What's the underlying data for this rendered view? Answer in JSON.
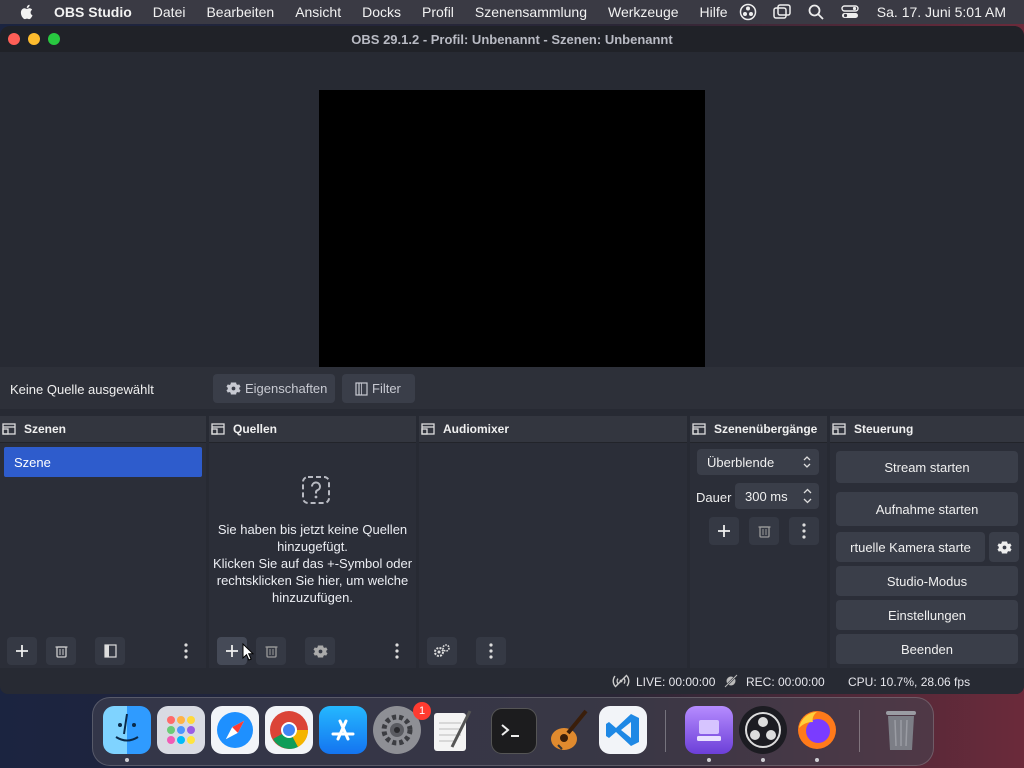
{
  "menubar": {
    "app_name": "OBS Studio",
    "items": [
      "Datei",
      "Bearbeiten",
      "Ansicht",
      "Docks",
      "Profil",
      "Szenensammlung",
      "Werkzeuge",
      "Hilfe"
    ],
    "clock": "Sa. 17. Juni  5:01 AM"
  },
  "window": {
    "title": "OBS 29.1.2 - Profil: Unbenannt - Szenen: Unbenannt"
  },
  "context_bar": {
    "no_source": "Keine Quelle ausgewählt",
    "properties_label": "Eigenschaften",
    "filter_label": "Filter"
  },
  "docks": {
    "scenes": {
      "title": "Szenen",
      "items": [
        "Szene"
      ]
    },
    "sources": {
      "title": "Quellen",
      "empty_lines": [
        "Sie haben bis jetzt keine Quellen",
        "hinzugefügt.",
        "Klicken Sie auf das +-Symbol oder",
        "rechtsklicken Sie hier, um welche",
        "hinzuzufügen."
      ]
    },
    "audio": {
      "title": "Audiomixer"
    },
    "transitions": {
      "title": "Szenenübergänge",
      "transition": "Überblende",
      "duration_label": "Dauer",
      "duration_value": "300 ms"
    },
    "controls": {
      "title": "Steuerung",
      "stream": "Stream starten",
      "record": "Aufnahme starten",
      "virtual_cam": "rtuelle Kamera starte",
      "studio": "Studio-Modus",
      "settings": "Einstellungen",
      "quit": "Beenden"
    }
  },
  "status": {
    "live": "LIVE: 00:00:00",
    "rec": "REC: 00:00:00",
    "cpu": "CPU: 10.7%, 28.06 fps"
  },
  "dock_apps": {
    "settings_badge": "1",
    "icons": [
      "finder-icon",
      "launchpad-icon",
      "safari-icon",
      "chrome-icon",
      "app-store-icon",
      "system-settings-icon",
      "textedit-icon",
      "terminal-icon",
      "garageband-icon",
      "vscode-icon",
      "disk-icon",
      "obs-icon",
      "firefox-icon",
      "trash-icon"
    ]
  },
  "colors": {
    "accent": "#2e5ccc",
    "window_bg": "#272a33",
    "dock_bg": "#2b2e38"
  }
}
